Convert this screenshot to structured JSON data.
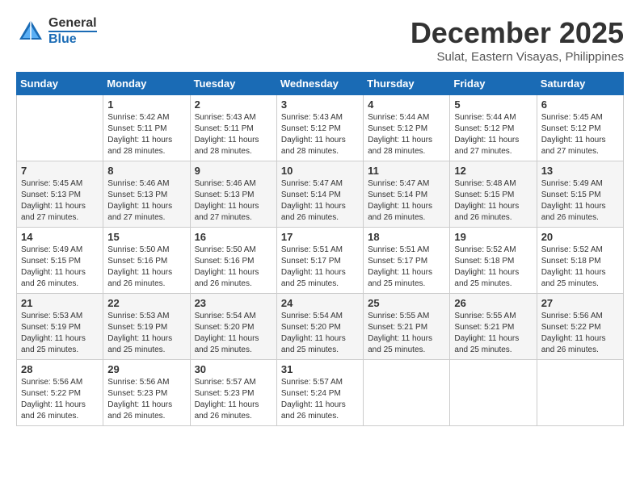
{
  "header": {
    "logo": {
      "general": "General",
      "blue": "Blue",
      "flag_unicode": "🏳"
    },
    "month_year": "December 2025",
    "location": "Sulat, Eastern Visayas, Philippines"
  },
  "calendar": {
    "days_of_week": [
      "Sunday",
      "Monday",
      "Tuesday",
      "Wednesday",
      "Thursday",
      "Friday",
      "Saturday"
    ],
    "weeks": [
      [
        {
          "day": "",
          "sunrise": "",
          "sunset": "",
          "daylight": ""
        },
        {
          "day": "1",
          "sunrise": "Sunrise: 5:42 AM",
          "sunset": "Sunset: 5:11 PM",
          "daylight": "Daylight: 11 hours and 28 minutes."
        },
        {
          "day": "2",
          "sunrise": "Sunrise: 5:43 AM",
          "sunset": "Sunset: 5:11 PM",
          "daylight": "Daylight: 11 hours and 28 minutes."
        },
        {
          "day": "3",
          "sunrise": "Sunrise: 5:43 AM",
          "sunset": "Sunset: 5:12 PM",
          "daylight": "Daylight: 11 hours and 28 minutes."
        },
        {
          "day": "4",
          "sunrise": "Sunrise: 5:44 AM",
          "sunset": "Sunset: 5:12 PM",
          "daylight": "Daylight: 11 hours and 28 minutes."
        },
        {
          "day": "5",
          "sunrise": "Sunrise: 5:44 AM",
          "sunset": "Sunset: 5:12 PM",
          "daylight": "Daylight: 11 hours and 27 minutes."
        },
        {
          "day": "6",
          "sunrise": "Sunrise: 5:45 AM",
          "sunset": "Sunset: 5:12 PM",
          "daylight": "Daylight: 11 hours and 27 minutes."
        }
      ],
      [
        {
          "day": "7",
          "sunrise": "Sunrise: 5:45 AM",
          "sunset": "Sunset: 5:13 PM",
          "daylight": "Daylight: 11 hours and 27 minutes."
        },
        {
          "day": "8",
          "sunrise": "Sunrise: 5:46 AM",
          "sunset": "Sunset: 5:13 PM",
          "daylight": "Daylight: 11 hours and 27 minutes."
        },
        {
          "day": "9",
          "sunrise": "Sunrise: 5:46 AM",
          "sunset": "Sunset: 5:13 PM",
          "daylight": "Daylight: 11 hours and 27 minutes."
        },
        {
          "day": "10",
          "sunrise": "Sunrise: 5:47 AM",
          "sunset": "Sunset: 5:14 PM",
          "daylight": "Daylight: 11 hours and 26 minutes."
        },
        {
          "day": "11",
          "sunrise": "Sunrise: 5:47 AM",
          "sunset": "Sunset: 5:14 PM",
          "daylight": "Daylight: 11 hours and 26 minutes."
        },
        {
          "day": "12",
          "sunrise": "Sunrise: 5:48 AM",
          "sunset": "Sunset: 5:15 PM",
          "daylight": "Daylight: 11 hours and 26 minutes."
        },
        {
          "day": "13",
          "sunrise": "Sunrise: 5:49 AM",
          "sunset": "Sunset: 5:15 PM",
          "daylight": "Daylight: 11 hours and 26 minutes."
        }
      ],
      [
        {
          "day": "14",
          "sunrise": "Sunrise: 5:49 AM",
          "sunset": "Sunset: 5:15 PM",
          "daylight": "Daylight: 11 hours and 26 minutes."
        },
        {
          "day": "15",
          "sunrise": "Sunrise: 5:50 AM",
          "sunset": "Sunset: 5:16 PM",
          "daylight": "Daylight: 11 hours and 26 minutes."
        },
        {
          "day": "16",
          "sunrise": "Sunrise: 5:50 AM",
          "sunset": "Sunset: 5:16 PM",
          "daylight": "Daylight: 11 hours and 26 minutes."
        },
        {
          "day": "17",
          "sunrise": "Sunrise: 5:51 AM",
          "sunset": "Sunset: 5:17 PM",
          "daylight": "Daylight: 11 hours and 25 minutes."
        },
        {
          "day": "18",
          "sunrise": "Sunrise: 5:51 AM",
          "sunset": "Sunset: 5:17 PM",
          "daylight": "Daylight: 11 hours and 25 minutes."
        },
        {
          "day": "19",
          "sunrise": "Sunrise: 5:52 AM",
          "sunset": "Sunset: 5:18 PM",
          "daylight": "Daylight: 11 hours and 25 minutes."
        },
        {
          "day": "20",
          "sunrise": "Sunrise: 5:52 AM",
          "sunset": "Sunset: 5:18 PM",
          "daylight": "Daylight: 11 hours and 25 minutes."
        }
      ],
      [
        {
          "day": "21",
          "sunrise": "Sunrise: 5:53 AM",
          "sunset": "Sunset: 5:19 PM",
          "daylight": "Daylight: 11 hours and 25 minutes."
        },
        {
          "day": "22",
          "sunrise": "Sunrise: 5:53 AM",
          "sunset": "Sunset: 5:19 PM",
          "daylight": "Daylight: 11 hours and 25 minutes."
        },
        {
          "day": "23",
          "sunrise": "Sunrise: 5:54 AM",
          "sunset": "Sunset: 5:20 PM",
          "daylight": "Daylight: 11 hours and 25 minutes."
        },
        {
          "day": "24",
          "sunrise": "Sunrise: 5:54 AM",
          "sunset": "Sunset: 5:20 PM",
          "daylight": "Daylight: 11 hours and 25 minutes."
        },
        {
          "day": "25",
          "sunrise": "Sunrise: 5:55 AM",
          "sunset": "Sunset: 5:21 PM",
          "daylight": "Daylight: 11 hours and 25 minutes."
        },
        {
          "day": "26",
          "sunrise": "Sunrise: 5:55 AM",
          "sunset": "Sunset: 5:21 PM",
          "daylight": "Daylight: 11 hours and 25 minutes."
        },
        {
          "day": "27",
          "sunrise": "Sunrise: 5:56 AM",
          "sunset": "Sunset: 5:22 PM",
          "daylight": "Daylight: 11 hours and 26 minutes."
        }
      ],
      [
        {
          "day": "28",
          "sunrise": "Sunrise: 5:56 AM",
          "sunset": "Sunset: 5:22 PM",
          "daylight": "Daylight: 11 hours and 26 minutes."
        },
        {
          "day": "29",
          "sunrise": "Sunrise: 5:56 AM",
          "sunset": "Sunset: 5:23 PM",
          "daylight": "Daylight: 11 hours and 26 minutes."
        },
        {
          "day": "30",
          "sunrise": "Sunrise: 5:57 AM",
          "sunset": "Sunset: 5:23 PM",
          "daylight": "Daylight: 11 hours and 26 minutes."
        },
        {
          "day": "31",
          "sunrise": "Sunrise: 5:57 AM",
          "sunset": "Sunset: 5:24 PM",
          "daylight": "Daylight: 11 hours and 26 minutes."
        },
        {
          "day": "",
          "sunrise": "",
          "sunset": "",
          "daylight": ""
        },
        {
          "day": "",
          "sunrise": "",
          "sunset": "",
          "daylight": ""
        },
        {
          "day": "",
          "sunrise": "",
          "sunset": "",
          "daylight": ""
        }
      ]
    ]
  }
}
